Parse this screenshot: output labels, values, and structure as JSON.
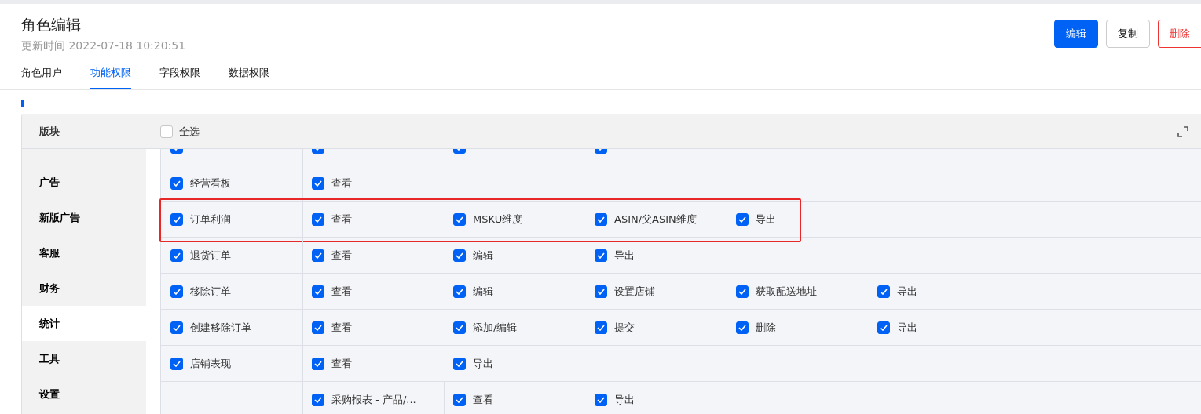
{
  "page": {
    "title": "角色编辑",
    "updated": "更新时间 2022-07-18 10:20:51"
  },
  "buttons": [
    {
      "label": "编辑",
      "kind": "primary"
    },
    {
      "label": "复制",
      "kind": "default"
    },
    {
      "label": "删除",
      "kind": "danger"
    }
  ],
  "tabs": [
    {
      "label": "角色用户",
      "selected": false
    },
    {
      "label": "功能权限",
      "selected": true
    },
    {
      "label": "字段权限",
      "selected": false
    },
    {
      "label": "数据权限",
      "selected": false
    }
  ],
  "table": {
    "block_header": "版块",
    "select_all": {
      "label": "全选",
      "checked": false
    },
    "sidebar": [
      {
        "label": "广告",
        "selected": false
      },
      {
        "label": "新版广告",
        "selected": false
      },
      {
        "label": "客服",
        "selected": false
      },
      {
        "label": "财务",
        "selected": false
      },
      {
        "label": "统计",
        "selected": true
      },
      {
        "label": "工具",
        "selected": false
      },
      {
        "label": "设置",
        "selected": false
      }
    ],
    "rows": [
      {
        "kind": "clipped",
        "highlighted": false,
        "module": {
          "checked": true
        },
        "perms": [
          {
            "checked": true
          },
          {
            "checked": true
          },
          {
            "checked": true
          }
        ]
      },
      {
        "kind": "module",
        "highlighted": false,
        "module": {
          "label": "经营看板",
          "checked": true
        },
        "perms": [
          {
            "label": "查看",
            "checked": true
          }
        ]
      },
      {
        "kind": "module",
        "highlighted": true,
        "module": {
          "label": "订单利润",
          "checked": true
        },
        "perms": [
          {
            "label": "查看",
            "checked": true
          },
          {
            "label": "MSKU维度",
            "checked": true
          },
          {
            "label": "ASIN/父ASIN维度",
            "checked": true
          },
          {
            "label": "导出",
            "checked": true
          }
        ]
      },
      {
        "kind": "module",
        "highlighted": false,
        "module": {
          "label": "退货订单",
          "checked": true
        },
        "perms": [
          {
            "label": "查看",
            "checked": true
          },
          {
            "label": "编辑",
            "checked": true
          },
          {
            "label": "导出",
            "checked": true
          }
        ]
      },
      {
        "kind": "module",
        "highlighted": false,
        "module": {
          "label": "移除订单",
          "checked": true
        },
        "perms": [
          {
            "label": "查看",
            "checked": true
          },
          {
            "label": "编辑",
            "checked": true
          },
          {
            "label": "设置店铺",
            "checked": true
          },
          {
            "label": "获取配送地址",
            "checked": true
          },
          {
            "label": "导出",
            "checked": true
          }
        ]
      },
      {
        "kind": "module",
        "highlighted": false,
        "module": {
          "label": "创建移除订单",
          "checked": true
        },
        "perms": [
          {
            "label": "查看",
            "checked": true
          },
          {
            "label": "添加/编辑",
            "checked": true
          },
          {
            "label": "提交",
            "checked": true
          },
          {
            "label": "删除",
            "checked": true
          },
          {
            "label": "导出",
            "checked": true
          }
        ]
      },
      {
        "kind": "module",
        "highlighted": false,
        "module": {
          "label": "店铺表现",
          "checked": true
        },
        "perms": [
          {
            "label": "查看",
            "checked": true
          },
          {
            "label": "导出",
            "checked": true
          }
        ]
      },
      {
        "kind": "group",
        "highlighted": false,
        "sub": {
          "label": "采购报表 - 产品/...",
          "checked": true
        },
        "perms": [
          {
            "label": "查看",
            "checked": true
          },
          {
            "label": "导出",
            "checked": true
          }
        ]
      }
    ]
  }
}
